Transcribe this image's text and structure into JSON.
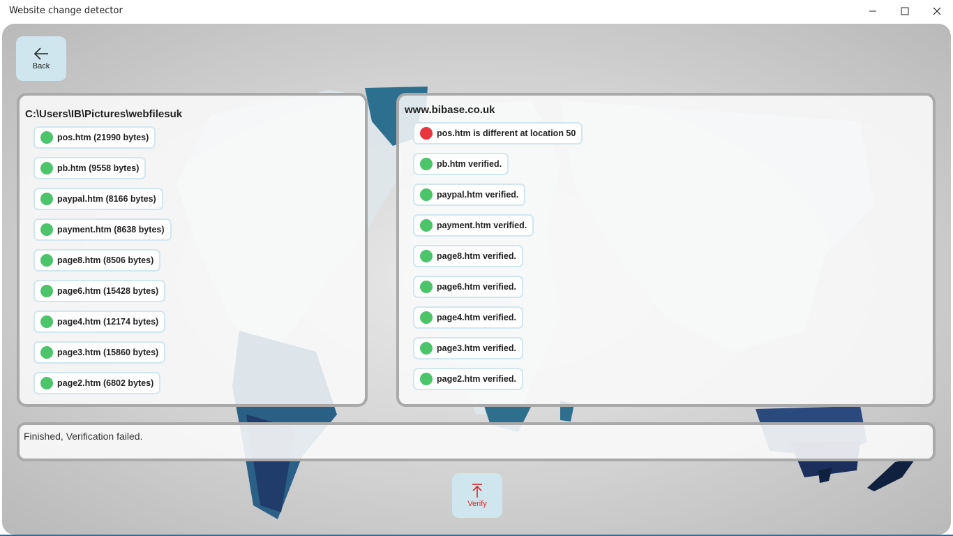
{
  "window": {
    "title": "Website change detector",
    "controls": [
      "minimize-icon",
      "maximize-icon",
      "close-icon"
    ]
  },
  "nav": {
    "back_label": "Back",
    "back_icon": "arrow-left-icon",
    "verify_label": "Verify",
    "verify_icon": "upload-arrow-icon"
  },
  "local": {
    "path": "C:\\Users\\IB\\Pictures\\webfilesuk",
    "files": [
      {
        "label": "pos.htm (21990 bytes)",
        "status": "ok"
      },
      {
        "label": "pb.htm (9558 bytes)",
        "status": "ok"
      },
      {
        "label": "paypal.htm (8166 bytes)",
        "status": "ok"
      },
      {
        "label": "payment.htm (8638 bytes)",
        "status": "ok"
      },
      {
        "label": "page8.htm (8506 bytes)",
        "status": "ok"
      },
      {
        "label": "page6.htm (15428 bytes)",
        "status": "ok"
      },
      {
        "label": "page4.htm (12174 bytes)",
        "status": "ok"
      },
      {
        "label": "page3.htm (15860 bytes)",
        "status": "ok"
      },
      {
        "label": "page2.htm (6802 bytes)",
        "status": "ok"
      }
    ]
  },
  "remote": {
    "site": "www.bibase.co.uk",
    "results": [
      {
        "label": "pos.htm is different at location 50",
        "status": "bad"
      },
      {
        "label": "pb.htm verified.",
        "status": "ok"
      },
      {
        "label": "paypal.htm verified.",
        "status": "ok"
      },
      {
        "label": "payment.htm verified.",
        "status": "ok"
      },
      {
        "label": "page8.htm verified.",
        "status": "ok"
      },
      {
        "label": "page6.htm verified.",
        "status": "ok"
      },
      {
        "label": "page4.htm verified.",
        "status": "ok"
      },
      {
        "label": "page3.htm verified.",
        "status": "ok"
      },
      {
        "label": "page2.htm verified.",
        "status": "ok"
      }
    ]
  },
  "status": {
    "message": "Finished, Verification failed."
  },
  "colors": {
    "ok": "#4cc46a",
    "bad": "#e9353f",
    "button_bg": "#cfe6ee",
    "verify_text": "#e02424"
  }
}
